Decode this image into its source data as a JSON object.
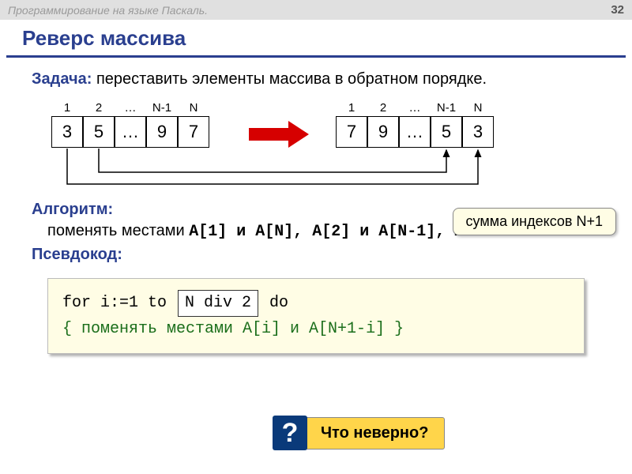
{
  "header": {
    "breadcrumb": "Программирование на языке Паскаль.",
    "page": "32"
  },
  "title": "Реверс массива",
  "task": {
    "label": "Задача:",
    "text": "переставить элементы массива в обратном порядке."
  },
  "arrays": {
    "indices": [
      "1",
      "2",
      "…",
      "N-1",
      "N"
    ],
    "left": [
      "3",
      "5",
      "…",
      "9",
      "7"
    ],
    "right": [
      "7",
      "9",
      "…",
      "5",
      "3"
    ]
  },
  "algorithm": {
    "label": "Алгоритм:",
    "text_prefix": "поменять местами ",
    "pairs": "A[1] и A[N], A[2] и A[N-1], …",
    "tooltip": "сумма индексов N+1"
  },
  "pseudocode": {
    "label": "Псевдокод:",
    "line1_pre": "for i:=1 to ",
    "line1_insert": "N div 2",
    "line1_post": " do",
    "line2": "{ поменять местами A[i] и A[N+1-i] }"
  },
  "question": {
    "mark": "?",
    "text": "Что неверно?"
  }
}
